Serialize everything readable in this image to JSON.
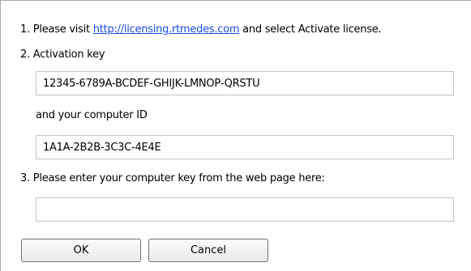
{
  "step1": {
    "prefix": "1. Please visit ",
    "link_text": "http://licensing.rtmedes.com",
    "suffix": " and select Activate license."
  },
  "step2": {
    "label": "2. Activation key",
    "activation_key_value": "12345-6789A-BCDEF-GHIJK-LMNOP-QRSTU",
    "computer_id_label": "and your computer ID",
    "computer_id_value": "1A1A-2B2B-3C3C-4E4E"
  },
  "step3": {
    "label": "3. Please enter your computer key from the web page here:",
    "computer_key_value": ""
  },
  "buttons": {
    "ok_label": "OK",
    "cancel_label": "Cancel"
  },
  "colors": {
    "link": "#1a4ee0",
    "field_border": "#c4c4c4",
    "button_border": "#707070"
  }
}
